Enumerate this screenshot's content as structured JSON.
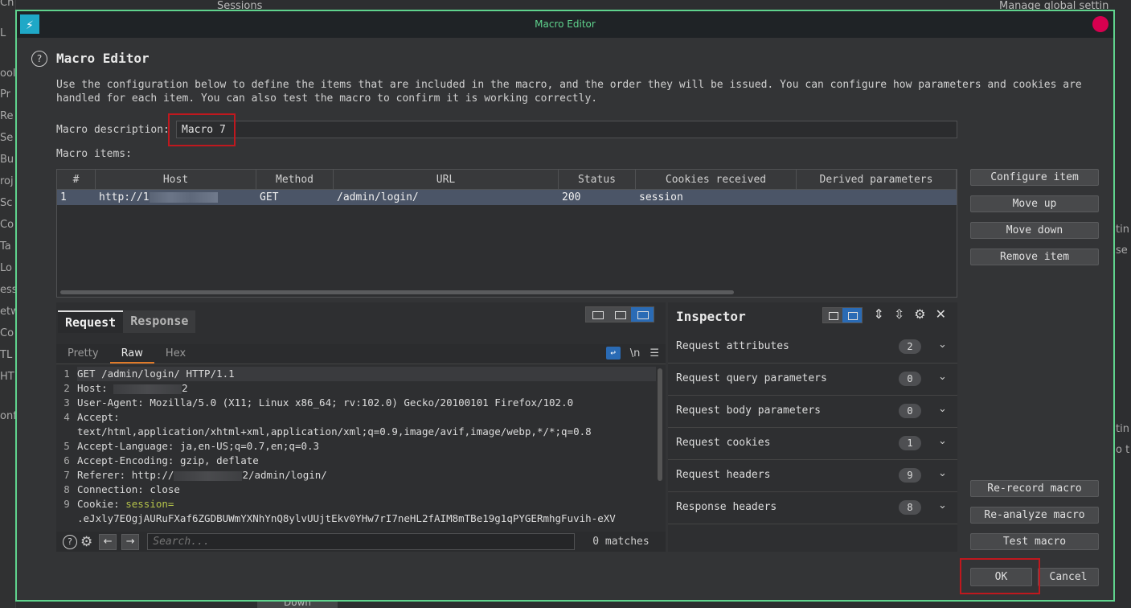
{
  "background": {
    "left_items": [
      "Ch",
      "L",
      "ool",
      "Pr",
      "Re",
      "Se",
      "Bu",
      "roj",
      "Sc",
      "Co",
      "Ta",
      "Lo",
      "ess",
      "etw",
      "Co",
      "TL",
      "HT",
      "onf"
    ],
    "top_label": "Sessions",
    "top_right_label": "Manage global settin",
    "right_items": [
      "tin",
      "se",
      "tin",
      "o t"
    ],
    "bottom_button": "Down"
  },
  "dialog": {
    "window_title": "Macro Editor",
    "heading": "Macro Editor",
    "intro": "Use the configuration below to define the items that are included in the macro, and the order they will be issued. You can configure how parameters and cookies are handled for each item. You can also test the macro to confirm it is working correctly.",
    "description_label": "Macro description:",
    "description_value": "Macro 7",
    "items_label": "Macro items:",
    "table": {
      "headers": [
        "#",
        "Host",
        "Method",
        "URL",
        "Status",
        "Cookies received",
        "Derived parameters"
      ],
      "rows": [
        {
          "num": "1",
          "host": "http://1",
          "method": "GET",
          "url": "/admin/login/",
          "status": "200",
          "cookies": "session",
          "derived": ""
        }
      ]
    },
    "side_buttons": {
      "configure": "Configure item",
      "move_up": "Move up",
      "move_down": "Move down",
      "remove": "Remove item",
      "rerecord": "Re-record macro",
      "reanalyze": "Re-analyze macro",
      "test": "Test macro"
    },
    "request_panel": {
      "tab_request": "Request",
      "tab_response": "Response",
      "subtab_pretty": "Pretty",
      "subtab_raw": "Raw",
      "subtab_hex": "Hex",
      "newline_label": "\\n",
      "lines": [
        {
          "n": "1",
          "key": "GET /admin/login/ HTTP/1.1",
          "val": ""
        },
        {
          "n": "2",
          "key": "Host:",
          "val": "2"
        },
        {
          "n": "3",
          "key": "User-Agent:",
          "val": "Mozilla/5.0 (X11; Linux x86_64; rv:102.0) Gecko/20100101 Firefox/102.0"
        },
        {
          "n": "4",
          "key": "Accept:",
          "val": ""
        },
        {
          "n": "",
          "key": "text/html,application/xhtml+xml,application/xml;q=0.9,image/avif,image/webp,*/*;q=0.8",
          "val": ""
        },
        {
          "n": "5",
          "key": "Accept-Language:",
          "val": "ja,en-US;q=0.7,en;q=0.3"
        },
        {
          "n": "6",
          "key": "Accept-Encoding:",
          "val": "gzip, deflate"
        },
        {
          "n": "7",
          "key": "Referer:",
          "val": "http://"
        },
        {
          "n": "8",
          "key": "Connection:",
          "val": "close"
        },
        {
          "n": "9",
          "key": "Cookie:",
          "val": "session="
        }
      ],
      "referer_tail": "2/admin/login/",
      "cookie_value": ".eJxly7EOgjAURuFXaf6ZGDBUWmYXNhYnQ8ylvUUjtEkv0YHw7rI7neHL2fAIM8mTBe19g1qPYGERmhgFuvih-eXV",
      "search_placeholder": "Search...",
      "matches": "0 matches"
    },
    "inspector": {
      "title": "Inspector",
      "rows": [
        {
          "label": "Request attributes",
          "count": "2"
        },
        {
          "label": "Request query parameters",
          "count": "0"
        },
        {
          "label": "Request body parameters",
          "count": "0"
        },
        {
          "label": "Request cookies",
          "count": "1"
        },
        {
          "label": "Request headers",
          "count": "9"
        },
        {
          "label": "Response headers",
          "count": "8"
        }
      ]
    },
    "ok_label": "OK",
    "cancel_label": "Cancel"
  }
}
